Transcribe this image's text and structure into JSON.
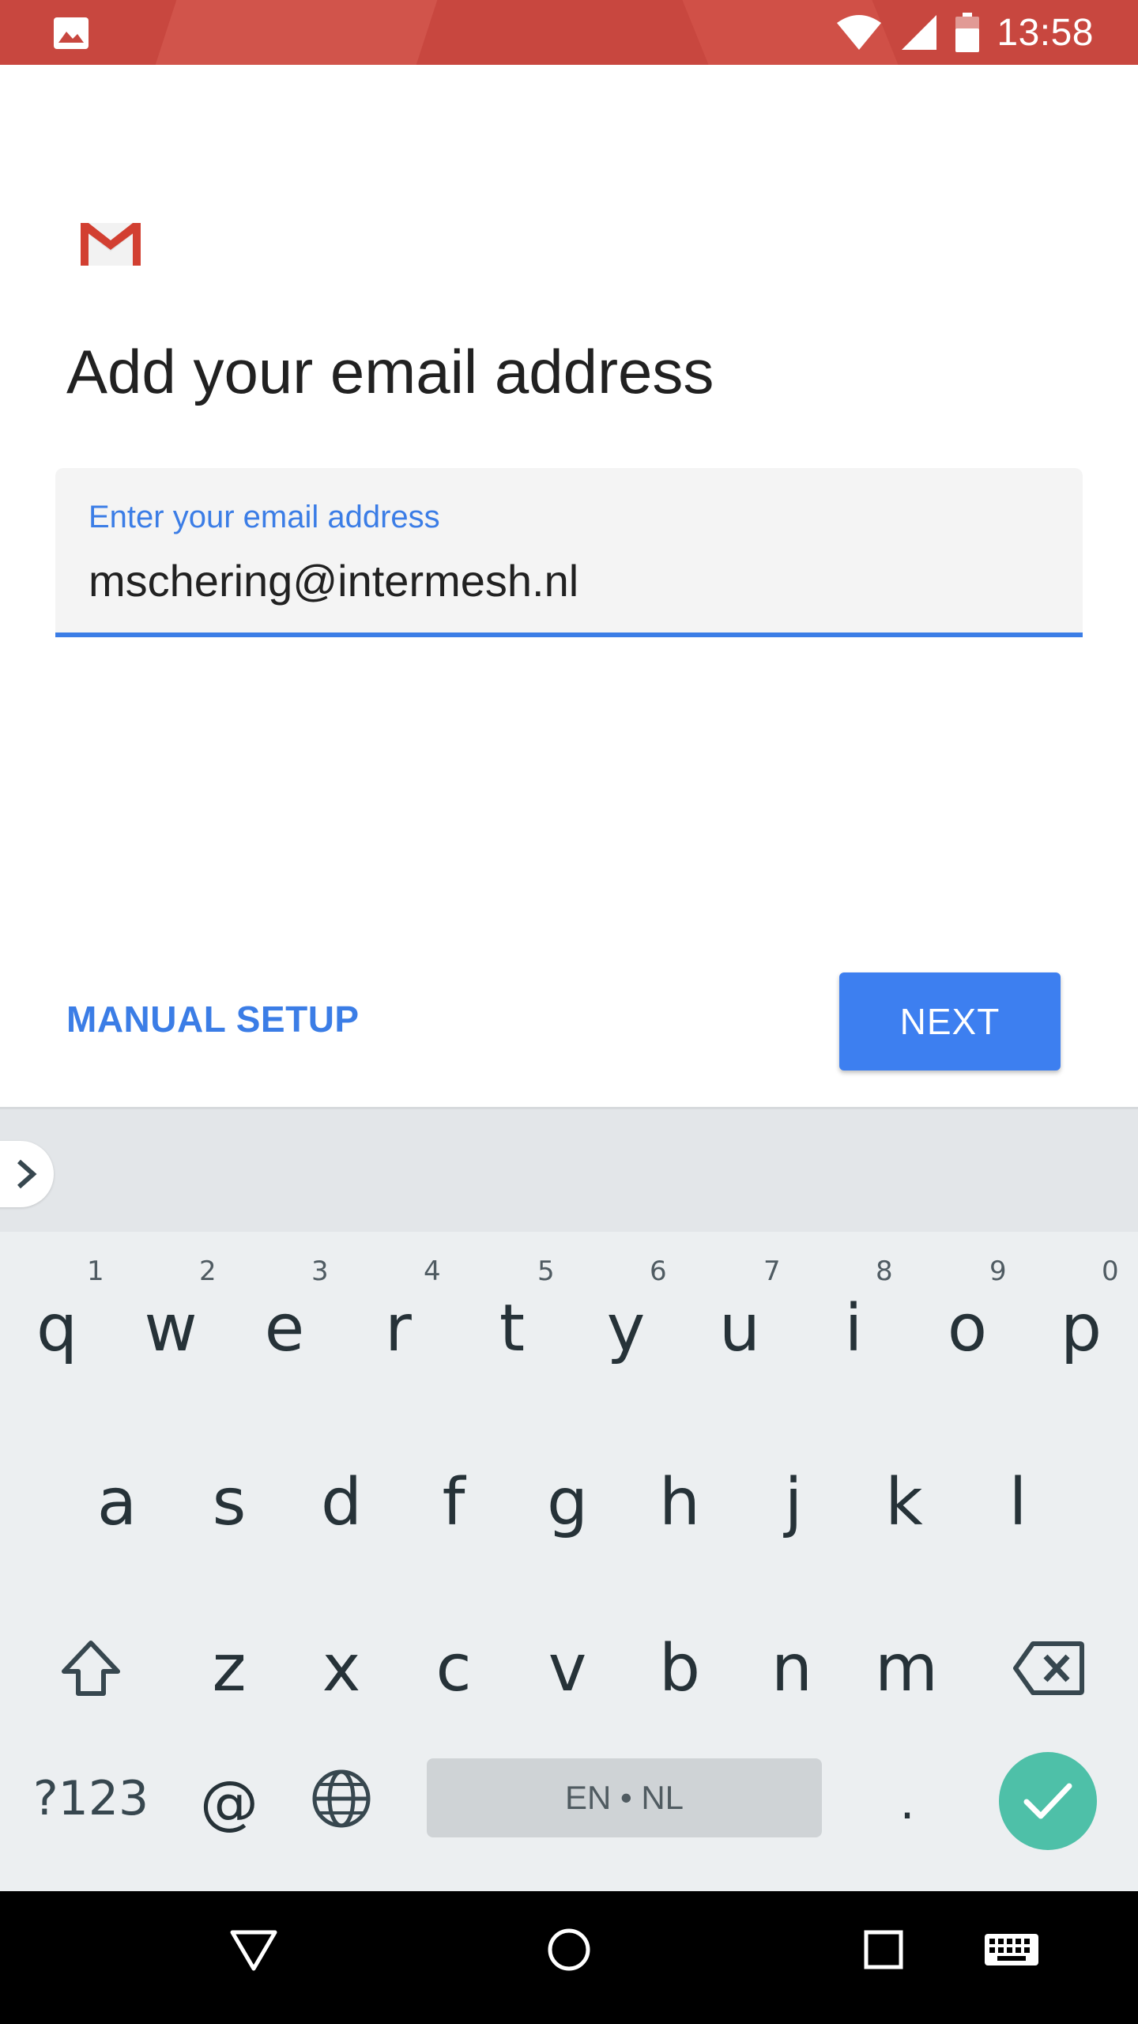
{
  "status_bar": {
    "time": "13:58",
    "left_icon": "image-notification-icon",
    "icons": [
      "wifi-icon",
      "signal-icon",
      "battery-icon"
    ],
    "color": "#c8473f"
  },
  "content": {
    "logo": "gmail-logo",
    "title": "Add your email address",
    "email_field": {
      "label": "Enter your email address",
      "value": "mschering@intermesh.nl"
    },
    "manual_setup_label": "MANUAL SETUP",
    "next_label": "NEXT",
    "accent_color": "#3b7de6"
  },
  "keyboard": {
    "row1": [
      {
        "letter": "q",
        "hint": "1"
      },
      {
        "letter": "w",
        "hint": "2"
      },
      {
        "letter": "e",
        "hint": "3"
      },
      {
        "letter": "r",
        "hint": "4"
      },
      {
        "letter": "t",
        "hint": "5"
      },
      {
        "letter": "y",
        "hint": "6"
      },
      {
        "letter": "u",
        "hint": "7"
      },
      {
        "letter": "i",
        "hint": "8"
      },
      {
        "letter": "o",
        "hint": "9"
      },
      {
        "letter": "p",
        "hint": "0"
      }
    ],
    "row2": [
      "a",
      "s",
      "d",
      "f",
      "g",
      "h",
      "j",
      "k",
      "l"
    ],
    "row3": [
      "z",
      "x",
      "c",
      "v",
      "b",
      "n",
      "m"
    ],
    "mode_key": "?123",
    "at_key": "@",
    "space_label": "EN • NL",
    "period_key": ".",
    "enter_color": "#4ec0a8"
  },
  "nav_bar": {
    "buttons": [
      "back-icon",
      "home-icon",
      "recents-icon",
      "keyboard-icon"
    ]
  }
}
